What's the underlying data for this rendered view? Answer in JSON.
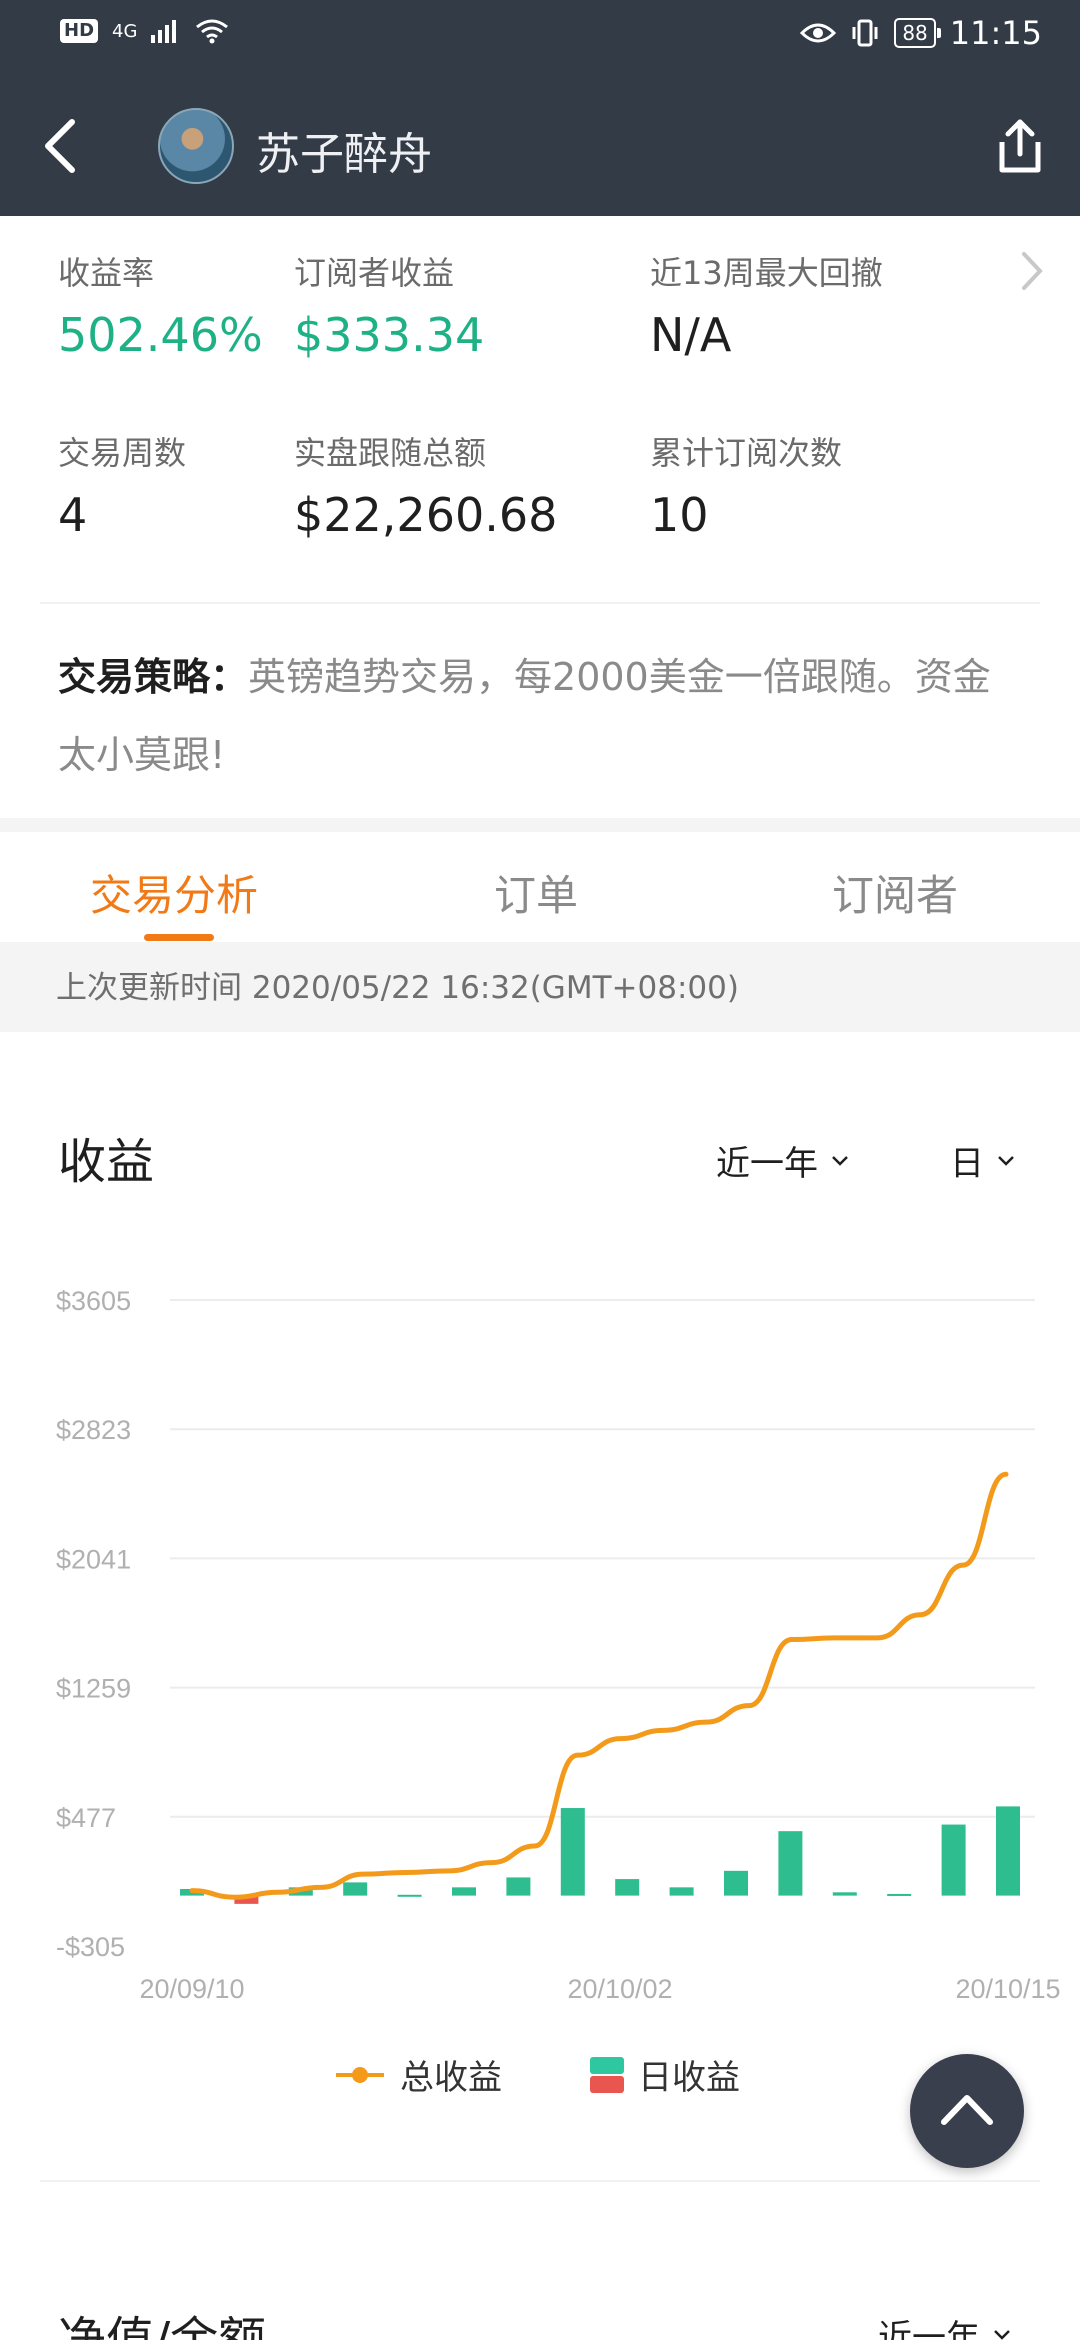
{
  "status_bar": {
    "hd": "HD",
    "network": "4G",
    "battery": "88",
    "time": "11:15"
  },
  "nav": {
    "title": "苏子醉舟"
  },
  "stats": [
    {
      "label": "收益率",
      "value": "502.46%",
      "color": "#1fb186"
    },
    {
      "label": "订阅者收益",
      "value": "$333.34",
      "color": "#1fb186"
    },
    {
      "label": "近13周最大回撤",
      "value": "N/A",
      "color": "#1f1f1f"
    },
    {
      "label": "交易周数",
      "value": "4",
      "color": "#1f1f1f"
    },
    {
      "label": "实盘跟随总额",
      "value": "$22,260.68",
      "color": "#1f1f1f"
    },
    {
      "label": "累计订阅次数",
      "value": "10",
      "color": "#1f1f1f"
    }
  ],
  "strategy": {
    "label": "交易策略：",
    "text": "英镑趋势交易，每2000美金一倍跟随。资金太小莫跟!"
  },
  "tabs": [
    {
      "label": "交易分析",
      "active": true
    },
    {
      "label": "订单",
      "active": false
    },
    {
      "label": "订阅者",
      "active": false
    }
  ],
  "update_time": "上次更新时间 2020/05/22 16:32(GMT+08:00)",
  "earnings_section": {
    "title": "收益",
    "range_dropdown": "近一年",
    "interval_dropdown": "日"
  },
  "colors": {
    "accent": "#f27a16",
    "positive": "#2ebd8e",
    "negative": "#e9564f",
    "topbar": "#333b47"
  },
  "chart_data": {
    "type": "bar",
    "title": "",
    "xlabel": "",
    "ylabel": "",
    "y_ticks": [
      "$3605",
      "$2823",
      "$2041",
      "$1259",
      "$477",
      "-$305"
    ],
    "ylim": [
      -305,
      3605
    ],
    "x_ticks": [
      "20/09/10",
      "20/10/02",
      "20/10/15"
    ],
    "grid": true,
    "legend_position": "bottom",
    "series": [
      {
        "name": "总收益",
        "type": "line",
        "color": "#f39a1b",
        "values": [
          30,
          -10,
          20,
          50,
          130,
          140,
          150,
          200,
          300,
          850,
          950,
          1000,
          1050,
          1150,
          1550,
          1560,
          1560,
          1700,
          2000,
          2550
        ]
      },
      {
        "name": "日收益",
        "type": "bar",
        "color_positive": "#2ebd8e",
        "color_negative": "#e9564f",
        "values": [
          40,
          -50,
          50,
          80,
          5,
          50,
          110,
          530,
          100,
          50,
          150,
          390,
          20,
          10,
          430,
          540
        ]
      }
    ]
  },
  "legend": {
    "total_label": "总收益",
    "daily_label": "日收益"
  },
  "net_value_section": {
    "title": "净值/余额",
    "range_dropdown": "近一年"
  }
}
